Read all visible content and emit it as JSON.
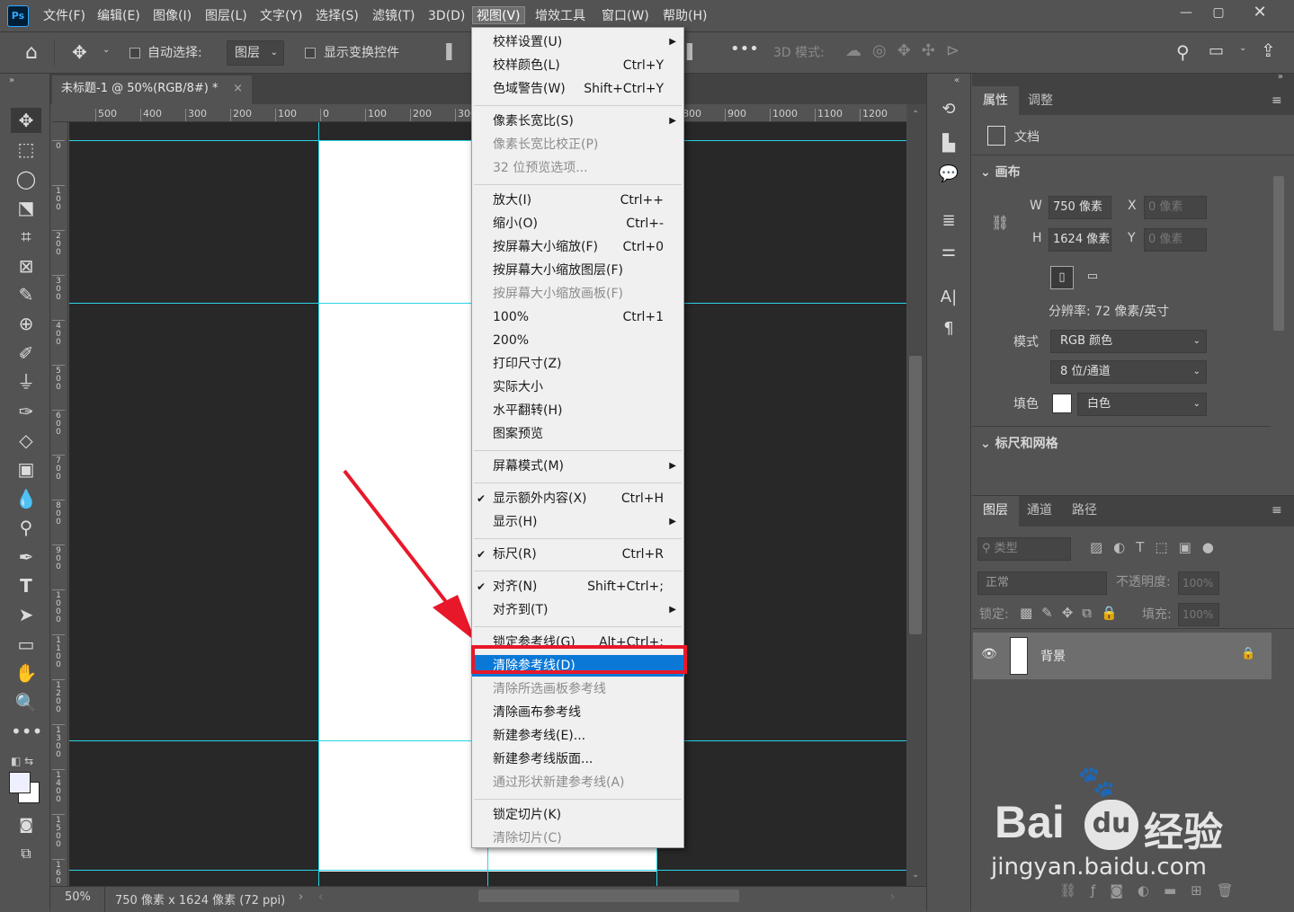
{
  "app": {
    "logo": "Ps"
  },
  "menubar": [
    "文件(F)",
    "编辑(E)",
    "图像(I)",
    "图层(L)",
    "文字(Y)",
    "选择(S)",
    "滤镜(T)",
    "3D(D)",
    "视图(V)",
    "增效工具",
    "窗口(W)",
    "帮助(H)"
  ],
  "options": {
    "auto_select_label": "自动选择:",
    "auto_select_value": "图层",
    "show_transform": "显示变换控件",
    "mode3d": "3D 模式:"
  },
  "document": {
    "tab_title": "未标题-1 @ 50%(RGB/8#) *",
    "close": "×"
  },
  "ruler": {
    "h": [
      "500",
      "400",
      "300",
      "200",
      "100",
      "0",
      "100",
      "200",
      "300",
      "400",
      "500",
      "600",
      "700",
      "800",
      "900",
      "1000",
      "1100",
      "1200"
    ],
    "v": [
      "0",
      "1\n0\n0",
      "2\n0\n0",
      "3\n0\n0",
      "4\n0\n0",
      "5\n0\n0",
      "6\n0\n0",
      "7\n0\n0",
      "8\n0\n0",
      "9\n0\n0",
      "1\n0\n0\n0",
      "1\n1\n0\n0",
      "1\n2\n0\n0",
      "1\n3\n0\n0",
      "1\n4\n0\n0",
      "1\n5\n0\n0",
      "1\n6\n0"
    ]
  },
  "status": {
    "zoom": "50%",
    "info": "750 像素 x 1624 像素 (72 ppi)"
  },
  "view_menu": {
    "items": [
      {
        "label": "校样设置(U)",
        "shortcut": "",
        "arrow": true
      },
      {
        "label": "校样颜色(L)",
        "shortcut": "Ctrl+Y"
      },
      {
        "label": "色域警告(W)",
        "shortcut": "Shift+Ctrl+Y"
      },
      {
        "sep": true
      },
      {
        "label": "像素长宽比(S)",
        "shortcut": "",
        "arrow": true
      },
      {
        "label": "像素长宽比校正(P)",
        "disabled": true
      },
      {
        "label": "32 位预览选项...",
        "disabled": true
      },
      {
        "sep": true
      },
      {
        "label": "放大(I)",
        "shortcut": "Ctrl++"
      },
      {
        "label": "缩小(O)",
        "shortcut": "Ctrl+-"
      },
      {
        "label": "按屏幕大小缩放(F)",
        "shortcut": "Ctrl+0"
      },
      {
        "label": "按屏幕大小缩放图层(F)"
      },
      {
        "label": "按屏幕大小缩放画板(F)",
        "disabled": true
      },
      {
        "label": "100%",
        "shortcut": "Ctrl+1"
      },
      {
        "label": "200%"
      },
      {
        "label": "打印尺寸(Z)"
      },
      {
        "label": "实际大小"
      },
      {
        "label": "水平翻转(H)"
      },
      {
        "label": "图案预览"
      },
      {
        "sep": true
      },
      {
        "label": "屏幕模式(M)",
        "arrow": true
      },
      {
        "sep": true
      },
      {
        "label": "显示额外内容(X)",
        "shortcut": "Ctrl+H",
        "checked": true
      },
      {
        "label": "显示(H)",
        "arrow": true
      },
      {
        "sep": true
      },
      {
        "label": "标尺(R)",
        "shortcut": "Ctrl+R",
        "checked": true
      },
      {
        "sep": true
      },
      {
        "label": "对齐(N)",
        "shortcut": "Shift+Ctrl+;",
        "checked": true
      },
      {
        "label": "对齐到(T)",
        "arrow": true
      },
      {
        "sep": true
      },
      {
        "label": "锁定参考线(G)",
        "shortcut": "Alt+Ctrl+;"
      },
      {
        "label": "清除参考线(D)",
        "highlighted": true
      },
      {
        "label": "清除所选画板参考线",
        "disabled": true
      },
      {
        "label": "清除画布参考线"
      },
      {
        "label": "新建参考线(E)..."
      },
      {
        "label": "新建参考线版面..."
      },
      {
        "label": "通过形状新建参考线(A)",
        "disabled": true
      },
      {
        "sep": true
      },
      {
        "label": "锁定切片(K)"
      },
      {
        "label": "清除切片(C)",
        "disabled": true
      }
    ]
  },
  "properties": {
    "tabs": [
      "属性",
      "调整"
    ],
    "doc_label": "文档",
    "canvas_section": "画布",
    "w_label": "W",
    "w_value": "750 像素",
    "x_label": "X",
    "x_value": "0 像素",
    "h_label": "H",
    "h_value": "1624 像素",
    "y_label": "Y",
    "y_value": "0 像素",
    "resolution": "分辨率: 72 像素/英寸",
    "mode_label": "模式",
    "mode_value": "RGB 颜色",
    "depth_value": "8 位/通道",
    "fill_label": "填色",
    "fill_value": "白色",
    "rulers_section": "标尺和网格"
  },
  "layers": {
    "tabs": [
      "图层",
      "通道",
      "路径"
    ],
    "filter": "类型",
    "blend": "正常",
    "opacity_label": "不透明度:",
    "opacity_value": "100%",
    "lock_label": "锁定:",
    "fill_label": "填充:",
    "fill_value": "100%",
    "layer_name": "背景"
  },
  "watermark": {
    "brand": "Bai",
    "brand2": "经验",
    "url": "jingyan.baidu.com"
  },
  "colors": {
    "highlight": "#0a78d7",
    "guide": "#28d4e6",
    "annotation": "#e8182a"
  }
}
